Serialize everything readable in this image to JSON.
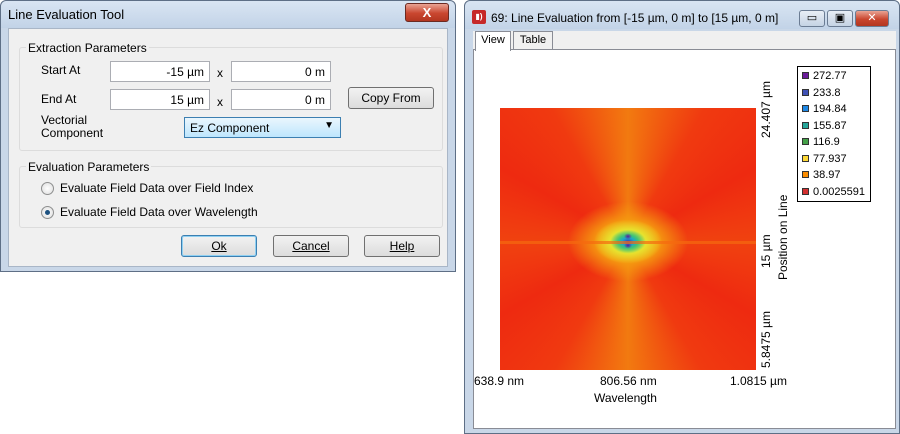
{
  "dialog": {
    "title": "Line Evaluation Tool",
    "close_label": "X",
    "extraction": {
      "group_title": "Extraction Parameters",
      "start_label": "Start At",
      "start_x": "-15 µm",
      "start_sep": "x",
      "start_y": "0 m",
      "end_label": "End At",
      "end_x": "15 µm",
      "end_sep": "x",
      "end_y": "0 m",
      "copy_from": "Copy From",
      "vectorial_label_1": "Vectorial",
      "vectorial_label_2": "Component",
      "component_value": "Ez Component"
    },
    "evaluation": {
      "group_title": "Evaluation Parameters",
      "option_index": "Evaluate Field Data over Field Index",
      "option_wavelength": "Evaluate Field Data over Wavelength",
      "selected": "wavelength"
    },
    "buttons": {
      "ok": "Ok",
      "cancel": "Cancel",
      "help": "Help"
    }
  },
  "plot_window": {
    "icon": "app-icon",
    "title": "69: Line Evaluation from [-15 µm, 0 m] to [15 µm, 0 m]",
    "tabs": [
      "View",
      "Table"
    ],
    "active_tab": "View"
  },
  "chart_data": {
    "type": "heatmap",
    "xlabel": "Wavelength",
    "ylabel": "Position on Line",
    "x_ticks": [
      "638.9 nm",
      "806.56 nm",
      "1.0815 µm"
    ],
    "y_ticks": [
      "24.407 µm",
      "15 µm",
      "5.8475 µm"
    ],
    "legend": [
      {
        "value": "272.77",
        "color": "#6a1b9a"
      },
      {
        "value": "233.8",
        "color": "#3f51b5"
      },
      {
        "value": "194.84",
        "color": "#1e88e5"
      },
      {
        "value": "155.87",
        "color": "#26a69a"
      },
      {
        "value": "116.9",
        "color": "#43a047"
      },
      {
        "value": "77.937",
        "color": "#fdd835"
      },
      {
        "value": "38.97",
        "color": "#fb8c00"
      },
      {
        "value": "0.0025591",
        "color": "#d32f2f"
      }
    ],
    "legend_position": "right"
  }
}
